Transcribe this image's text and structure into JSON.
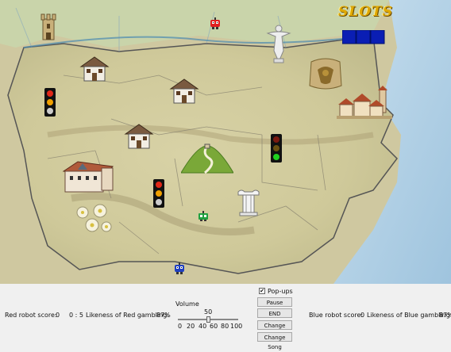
{
  "slots": {
    "label": "SLOTS"
  },
  "blue_slots_squares": 3,
  "controls": {
    "red_score_label": "Red robot score:",
    "red_score": "0",
    "red_score_separator": "0 : 5",
    "red_likeness_label": "Likeness of Red gambling:",
    "red_likeness": "87%",
    "volume_label": "Volume",
    "volume_value": "50",
    "volume_level": 50,
    "volume_ticks": [
      "0",
      "20",
      "40",
      "60",
      "80",
      "100"
    ],
    "popups_checked": true,
    "popups_label": "Pop-ups",
    "pause_label": "Pause",
    "end_label": "END",
    "change_colors_label": "Change Colors",
    "change_song_label": "Change Song",
    "blue_score_label": "Blue robot score:",
    "blue_score": "0",
    "blue_likeness_label": "Likeness of Blue gambling:",
    "blue_likeness": "87%"
  },
  "traffic_lights": [
    {
      "name": "traffic-light-west",
      "state": "yellow-red"
    },
    {
      "name": "traffic-light-center",
      "state": "red-yellow"
    },
    {
      "name": "traffic-light-east",
      "state": "green"
    }
  ],
  "colors": {
    "sea": "#bcd6e8",
    "land": "#d9d3a8",
    "red_robot": "#e02020",
    "blue_robot": "#2040c0",
    "slots_blue": "#0a1eb4"
  }
}
